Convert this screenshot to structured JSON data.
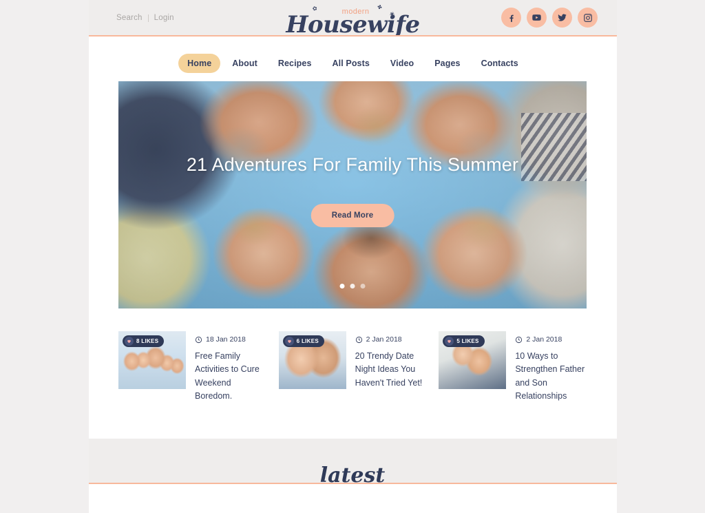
{
  "theme": {
    "coral": "#f9bda3",
    "coral_line": "#f8b89b",
    "navy": "#374160",
    "navy_dark": "#2f3a58",
    "gold": "#f4d29a",
    "page_bg": "#f1efef",
    "panel_bg": "#efedec",
    "white": "#ffffff",
    "muted": "#a9a6a4"
  },
  "topbar": {
    "search_label": "Search",
    "login_label": "Login"
  },
  "logo": {
    "pretitle": "modern",
    "title": "Housewife"
  },
  "socials": [
    {
      "name": "facebook-icon",
      "label": "Facebook"
    },
    {
      "name": "youtube-icon",
      "label": "YouTube"
    },
    {
      "name": "twitter-icon",
      "label": "Twitter"
    },
    {
      "name": "instagram-icon",
      "label": "Instagram"
    }
  ],
  "nav": {
    "items": [
      {
        "label": "Home",
        "active": true
      },
      {
        "label": "About",
        "active": false
      },
      {
        "label": "Recipes",
        "active": false
      },
      {
        "label": "All Posts",
        "active": false
      },
      {
        "label": "Video",
        "active": false
      },
      {
        "label": "Pages",
        "active": false
      },
      {
        "label": "Contacts",
        "active": false
      }
    ]
  },
  "hero": {
    "title": "21 Adventures For Family This Summer",
    "button_label": "Read More",
    "slide_count": 3,
    "active_slide": 1
  },
  "cards": [
    {
      "likes": "8 LIKES",
      "date": "18 Jan 2018",
      "title": "Free Family Activities to Cure Weekend Boredom."
    },
    {
      "likes": "6 LIKES",
      "date": "2 Jan 2018",
      "title": "20 Trendy Date Night Ideas You Haven't Tried Yet!"
    },
    {
      "likes": "5 LIKES",
      "date": "2 Jan 2018",
      "title": "10 Ways to Strengthen Father and Son Relationships"
    }
  ],
  "latest": {
    "heading": "latest"
  }
}
